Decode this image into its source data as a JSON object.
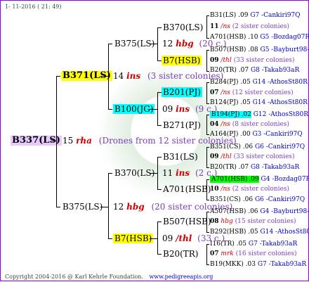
{
  "header": {
    "date": "1- 11-2016 ( 21: 49)"
  },
  "footer": {
    "copyright": "Copyright 2004-2016 @ Karl Kehrle Foundation.",
    "site": "www.pedigreeapis.org"
  },
  "root": {
    "label": "B337(LS)",
    "num": "15",
    "gene": "rha",
    "info": "(Drones from 12 sister colonies)"
  },
  "gen1": [
    {
      "label": "B371(LS)",
      "num": "14",
      "gene": "ins",
      "info": "(3 sister colonies)"
    },
    {
      "label": "B375(LS)",
      "num": "12",
      "gene": "hbg",
      "info": "(20 sister colonies)"
    }
  ],
  "gen2": [
    {
      "label": "B375(LS)",
      "num": "12",
      "gene": "hbg",
      "info": "(20 c.)"
    },
    {
      "label": "B100(JG)",
      "num": "09",
      "gene": "ins",
      "info": "(9 c.)"
    },
    {
      "label": "B370(LS)",
      "num": "11",
      "gene": "ins",
      "info": "(2 c.)"
    },
    {
      "label": "B7(HSB)",
      "num": "09",
      "gene": "/thl",
      "info": "(33 c.)"
    }
  ],
  "gen3": [
    {
      "label": "B370(LS)"
    },
    {
      "label": "B7(HSB)"
    },
    {
      "label": "B201(PJ)"
    },
    {
      "label": "B271(PJ)"
    },
    {
      "label": "B31(LS)"
    },
    {
      "label": "A701(HSB)"
    },
    {
      "label": "B507(HSB)"
    },
    {
      "label": "B20(TR)"
    }
  ],
  "gen4": [
    {
      "name": "B31(LS)",
      "code": ".09",
      "loc": "G7 -Cankiri97Q"
    },
    {
      "num": "11",
      "gene": "/ns",
      "info": "(2 sister colonies)"
    },
    {
      "name": "A701(HSB)",
      "code": ".10",
      "loc": "G5 -Bozdag07R"
    },
    {
      "name": "B507(HSB)",
      "code": ".08",
      "loc": "G5 -Bayburt98-3"
    },
    {
      "num": "09",
      "gene": "/thl",
      "info": "(33 sister colonies)"
    },
    {
      "name": "B20(TR)",
      "code": ".07",
      "loc": "G8 -Takab93aR"
    },
    {
      "name": "B284(PJ)",
      "code": ".05",
      "loc": "G14 -AthosSt80R"
    },
    {
      "num": "07",
      "gene": "/ns",
      "info": "(12 sister colonies)"
    },
    {
      "name": "B124(PJ)",
      "code": ".05",
      "loc": "G14 -AthosSt80R"
    },
    {
      "name": "B194(PJ)",
      "code": ".02",
      "loc": "G12 -AthosSt80R"
    },
    {
      "num": "04",
      "gene": "/ns",
      "info": "(8 sister colonies)"
    },
    {
      "name": "A164(PJ)",
      "code": ".00",
      "loc": "G3 -Cankiri97Q"
    },
    {
      "name": "B351(CS)",
      "code": ".06",
      "loc": "G6 -Cankiri97Q"
    },
    {
      "num": "09",
      "gene": "/thl",
      "info": "(33 sister colonies)"
    },
    {
      "name": "B20(TR)",
      "code": ".07",
      "loc": "G8 -Takab93aR"
    },
    {
      "name": "A701(HSB)",
      "code": ".09",
      "loc": "G4 -Bozdag07R"
    },
    {
      "num": "10",
      "gene": "/ns",
      "info": "(2 sister colonies)"
    },
    {
      "name": "B351(CS)",
      "code": ".06",
      "loc": "G6 -Cankiri97Q"
    },
    {
      "name": "A507(HSB)",
      "code": ".06",
      "loc": "G4 -Bayburt98-3"
    },
    {
      "num": "08",
      "gene": "hbg",
      "info": "(15 sister colonies)"
    },
    {
      "name": "B292(HSB)",
      "code": ".05",
      "loc": "G14 -AthosSt80R"
    },
    {
      "name": "I16(TR)",
      "code": ".05",
      "loc": "G7 -Takab93aR"
    },
    {
      "num": "07",
      "gene": "mrk",
      "info": "(16 sister colonies)"
    },
    {
      "name": "B19(MKK)",
      "code": ".03",
      "loc": "G7 -Takab93aR"
    }
  ]
}
